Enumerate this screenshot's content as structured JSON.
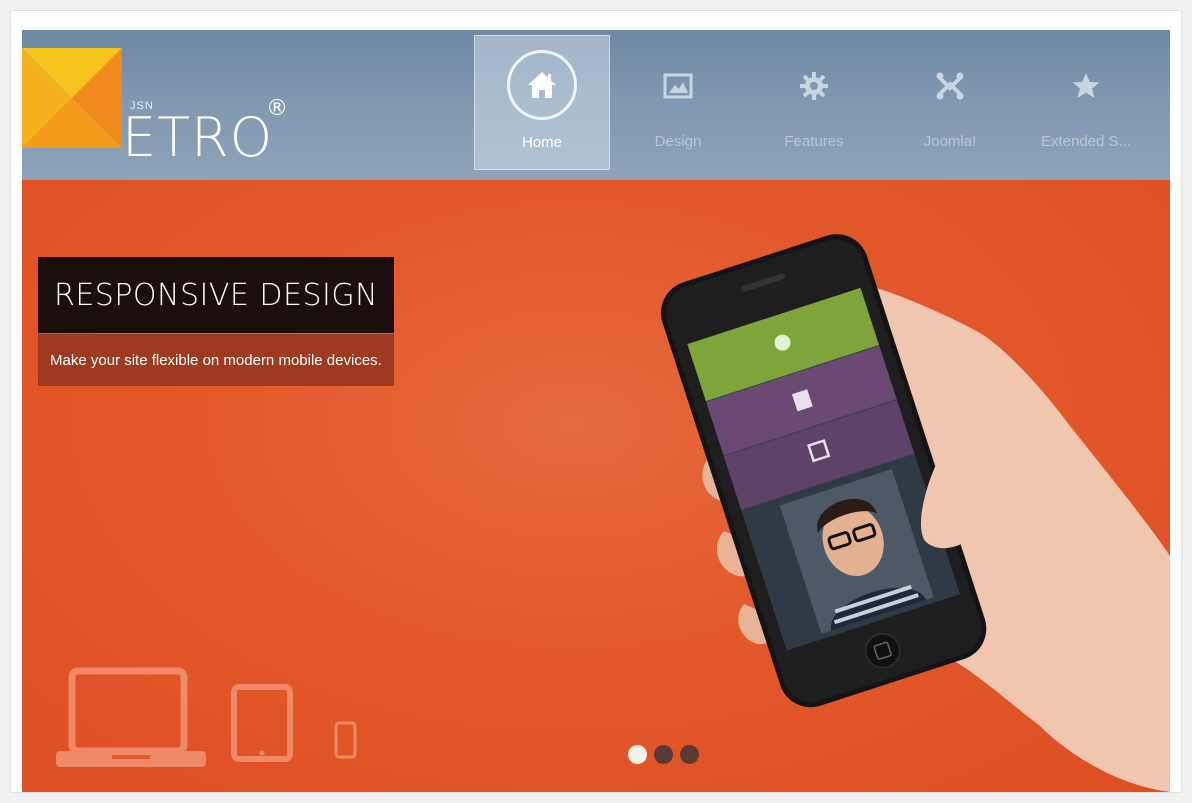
{
  "logo": {
    "jsn": "JSN",
    "word": "ETRO",
    "reg": "®"
  },
  "nav": [
    {
      "label": "Home",
      "icon": "home-icon",
      "active": true
    },
    {
      "label": "Design",
      "icon": "image-icon",
      "active": false
    },
    {
      "label": "Features",
      "icon": "gear-icon",
      "active": false
    },
    {
      "label": "Joomla!",
      "icon": "joomla-icon",
      "active": false
    },
    {
      "label": "Extended S...",
      "icon": "star-icon",
      "active": false
    }
  ],
  "hero": {
    "headline": "RESPONSIVE DESIGN",
    "subtitle": "Make your site flexible on modern mobile devices.",
    "slide_count": 3,
    "active_slide": 1
  },
  "colors": {
    "header": "#7f97b0",
    "hero_orange": "#e3582a",
    "logo_yellow": "#f6b817",
    "logo_orange": "#f07f1a",
    "tile_green": "#7da53a",
    "tile_purple": "#6a4a73"
  }
}
